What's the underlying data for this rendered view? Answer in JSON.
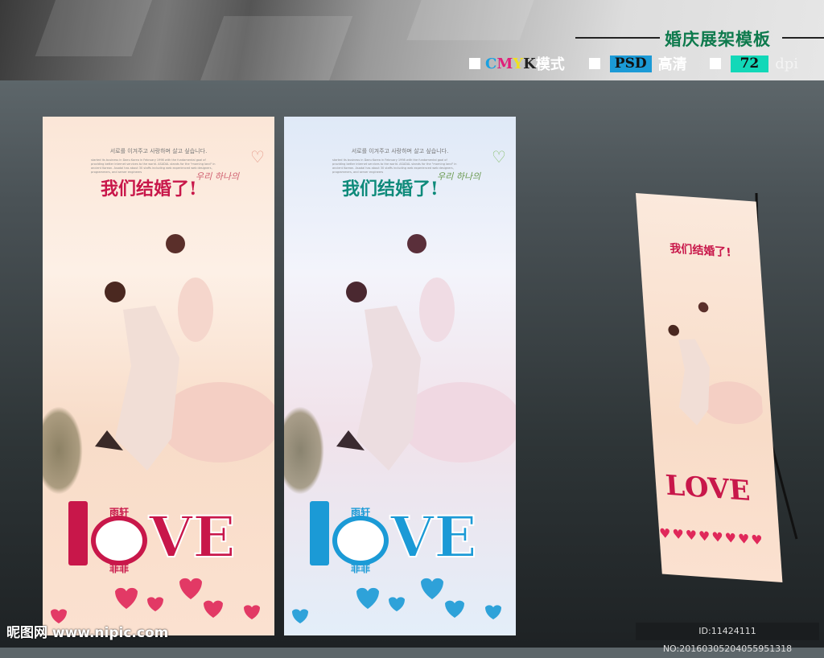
{
  "header": {
    "title": "婚庆展架模板",
    "color_mode_letters": [
      "C",
      "M",
      "Y",
      "K"
    ],
    "color_mode_suffix": "模式",
    "format": "PSD",
    "quality": "高清",
    "resolution": "72",
    "resolution_unit": "dpi"
  },
  "poster": {
    "korean_line": "서로를 이겨주고 사랑하며 살고 싶습니다.",
    "english_text": "started its business in Daeu Korea in February 1998 with the fundamental goal of providing better internet services to the world. ASADAL stands for the \"morning land\" in ancient Korean. Asadal has about 30 staffs including web experienced web designers, programmers, and server engineers",
    "headline": "我们结婚了!",
    "script": "우리 하나의",
    "love_l": "L",
    "love_ve": "VE",
    "logo_top": "雨轩",
    "logo_bottom": "菲菲"
  },
  "colors": {
    "pink": "#c8174a",
    "blue": "#1b9ad6",
    "teal": "#0e8a7a",
    "green_title": "#0e7a4d"
  },
  "footer": {
    "watermark": "昵图网 www.nipic.com",
    "id_text": "ID:11424111 NO:20160305204055951318"
  }
}
